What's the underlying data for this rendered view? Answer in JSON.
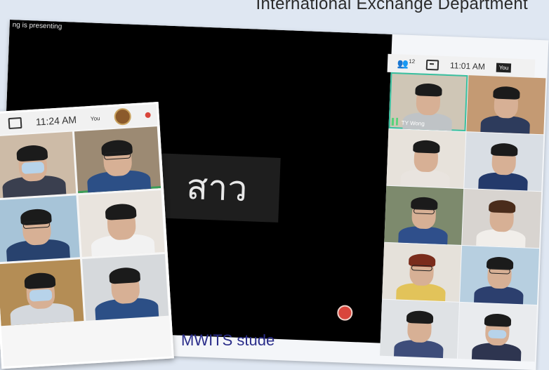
{
  "header": {
    "title": "International Exchange Department"
  },
  "main_meeting": {
    "presenting_text": "ng is presenting",
    "presented_word": "สาว",
    "participants_count": "12",
    "time": "11:01 AM",
    "you_label": "You",
    "speaker_name": "TY Wong",
    "icons": [
      "people-icon",
      "chat-icon",
      "mic-icon",
      "record-icon"
    ]
  },
  "caption": {
    "text": "MWITS stude"
  },
  "small_meeting": {
    "time": "11:24 AM",
    "you_label": "You"
  },
  "colors": {
    "accent_green": "#3a9d57",
    "record_red": "#d9453b",
    "caption_blue": "#2a2d8a"
  }
}
